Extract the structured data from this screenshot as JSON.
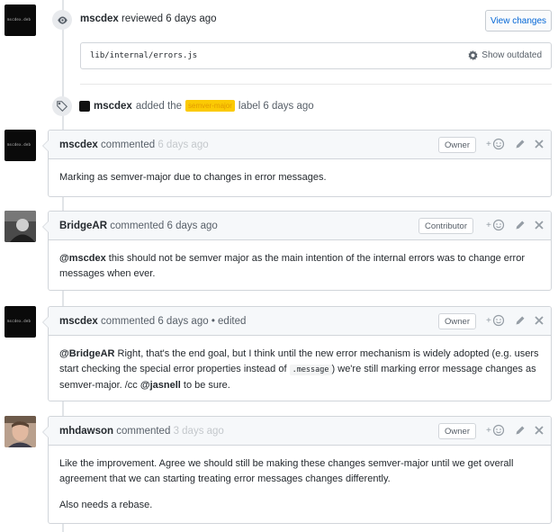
{
  "review": {
    "user": "mscdex",
    "action": "reviewed",
    "time": "6 days ago",
    "view_changes_label": "View changes",
    "file_path": "lib/internal/errors.js",
    "show_outdated_label": "Show outdated"
  },
  "label_event": {
    "user": "mscdex",
    "action_prefix": "added the",
    "label_name": "semver-major",
    "action_suffix": "label 6 days ago",
    "label_color": "#fbca04"
  },
  "comments": [
    {
      "user": "mscdex",
      "verb": "commented",
      "time": "6 days ago",
      "role": "Owner",
      "body": "Marking as semver-major due to changes in error messages."
    },
    {
      "user": "BridgeAR",
      "verb": "commented",
      "time": "6 days ago",
      "role": "Contributor",
      "body_mention": "@mscdex",
      "body_rest": " this should not be semver major as the main intention of the internal errors was to change error messages when ever."
    },
    {
      "user": "mscdex",
      "verb": "commented",
      "time": "6 days ago",
      "edited": "• edited",
      "role": "Owner",
      "body_mention": "@BridgeAR",
      "body_part1": " Right, that's the end goal, but I think until the new error mechanism is widely adopted (e.g. users start checking the special error properties instead of ",
      "body_code": ".message",
      "body_part2": ") we're still marking error message changes as semver-major. /cc ",
      "body_mention2": "@jasnell",
      "body_part3": " to be sure."
    },
    {
      "user": "mhdawson",
      "verb": "commented",
      "time": "3 days ago",
      "role": "Owner",
      "body_p1": "Like the improvement. Agree we should still be making these changes semver-major until we get overall agreement that we can starting treating error messages changes differently.",
      "body_p2": "Also needs a rebase."
    }
  ],
  "avatar_text": "mscdex.deb",
  "icons": [
    "eye-icon",
    "tag-icon",
    "add-reaction-icon",
    "pencil-icon",
    "close-icon",
    "gear-icon"
  ],
  "colors": {
    "link": "#0366d6",
    "border": "#d1d5da",
    "header_bg": "#f6f8fa",
    "muted": "#586069"
  }
}
